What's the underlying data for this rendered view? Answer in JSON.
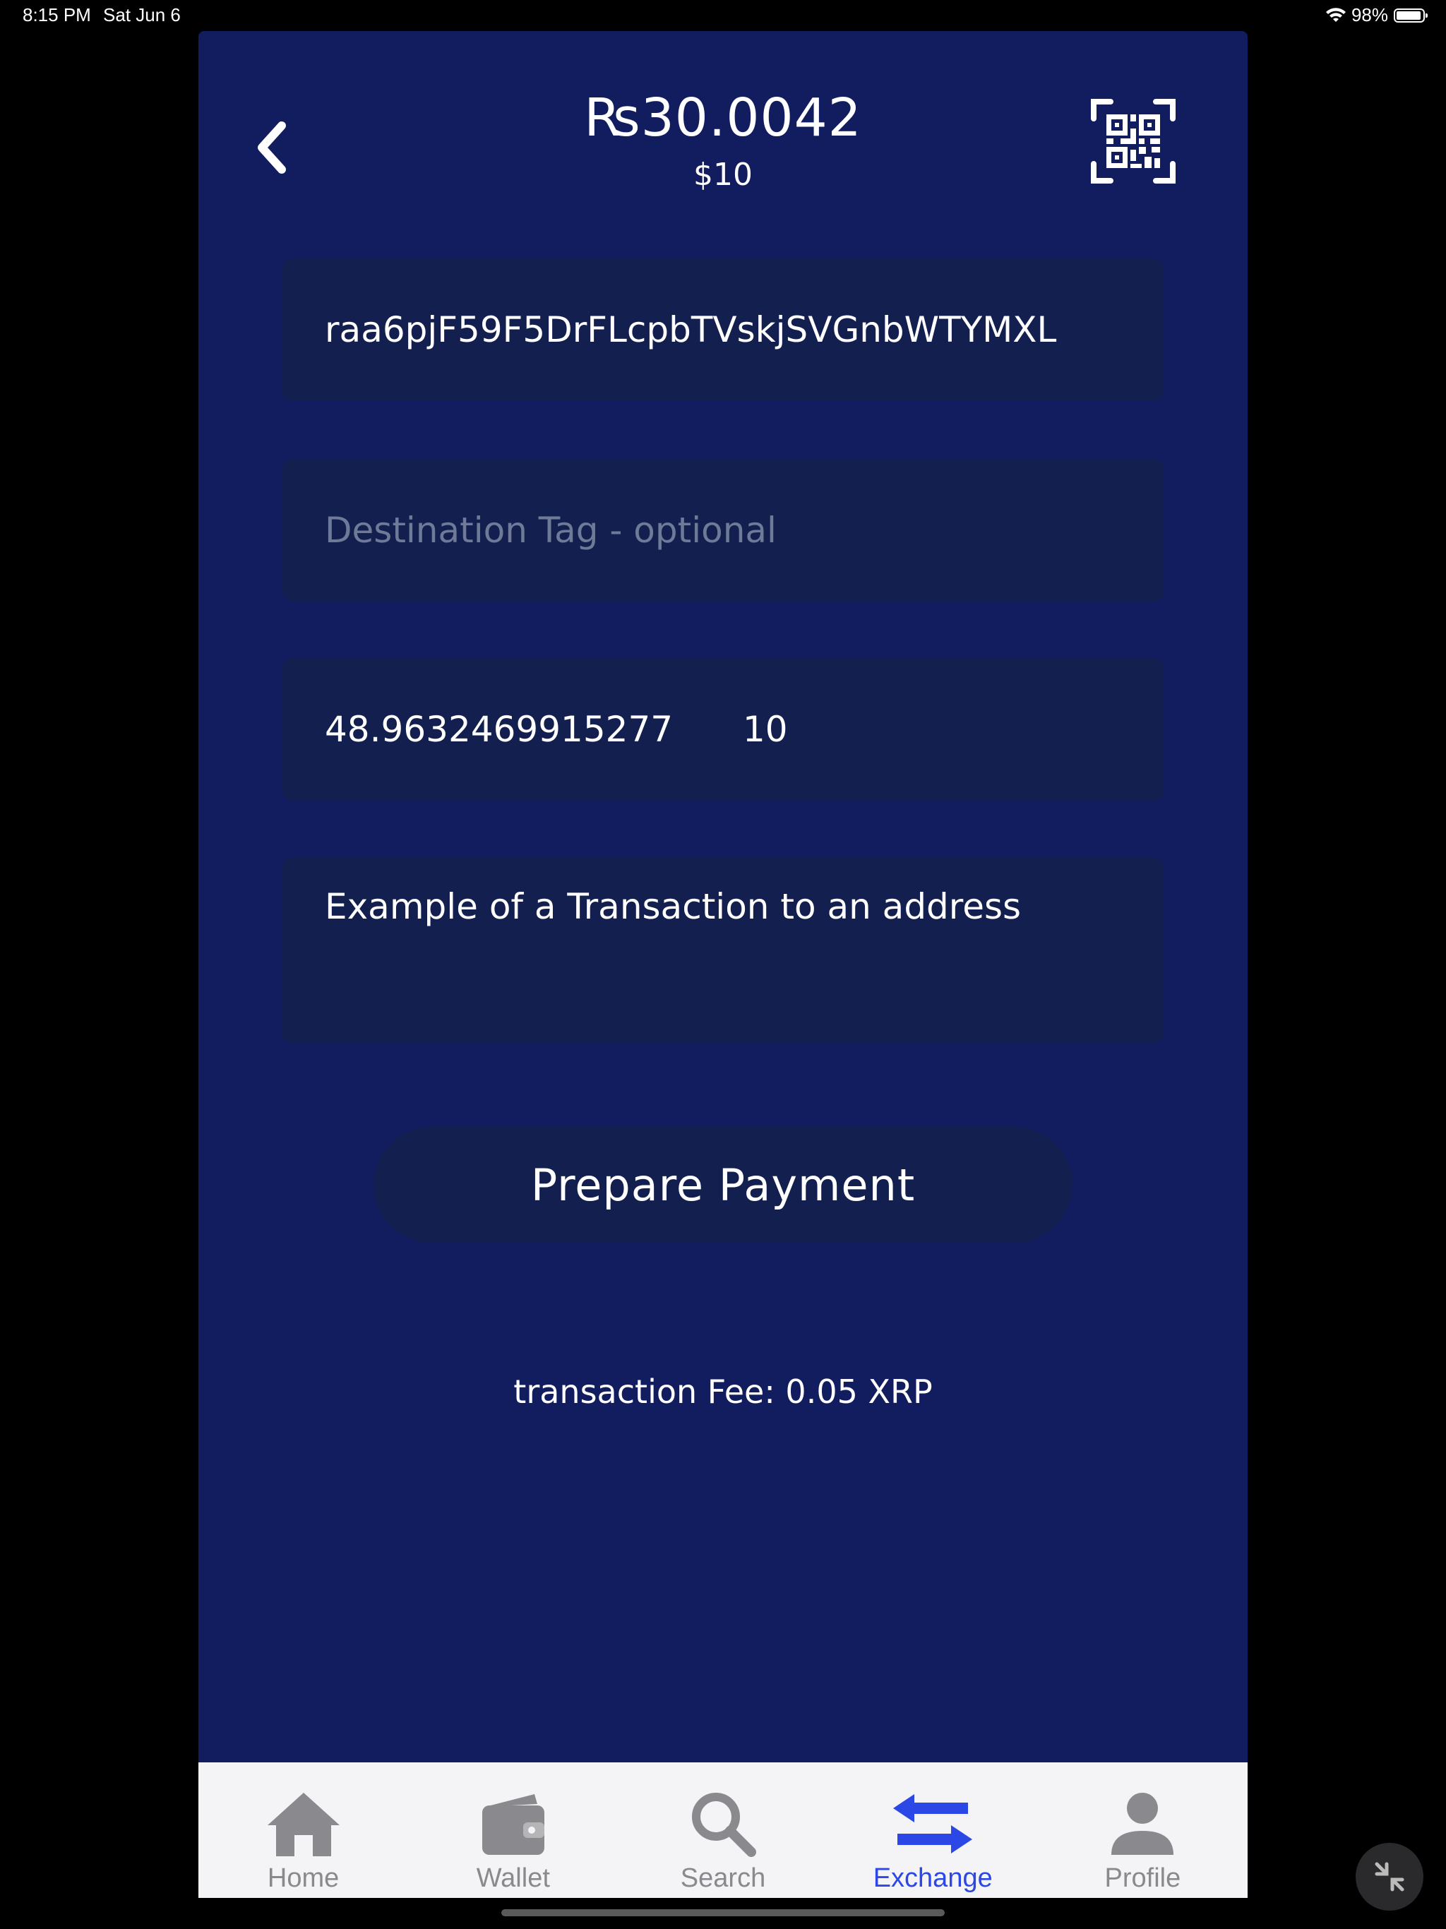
{
  "status": {
    "time": "8:15 PM",
    "date": "Sat Jun 6",
    "battery": "98%"
  },
  "header": {
    "amount": "₨30.0042",
    "fiat": "$10"
  },
  "form": {
    "address": "raa6pjF59F5DrFLcpbTVskjSVGnbWTYMXL",
    "destination_tag_placeholder": "Destination Tag - optional",
    "amount_xrp": "48.9632469915277",
    "amount_usd": "10",
    "memo": "Example of a Transaction to an address"
  },
  "prepare_label": "Prepare Payment",
  "fee_text": "transaction Fee: 0.05 XRP",
  "tabs": [
    {
      "label": "Home",
      "icon": "home-icon"
    },
    {
      "label": "Wallet",
      "icon": "wallet-icon"
    },
    {
      "label": "Search",
      "icon": "search-icon"
    },
    {
      "label": "Exchange",
      "icon": "exchange-icon"
    },
    {
      "label": "Profile",
      "icon": "profile-icon"
    }
  ],
  "colors": {
    "background": "#111d5e",
    "field": "#131f4f",
    "active_tab": "#2b48e6",
    "inactive_tab": "#8a8a8e"
  }
}
